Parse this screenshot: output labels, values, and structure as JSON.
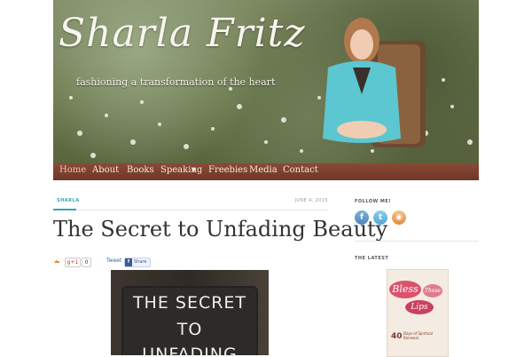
{
  "site": {
    "title": "Sharla Fritz",
    "tagline": "fashioning a transformation of the heart"
  },
  "nav": {
    "items": [
      "Home",
      "About",
      "Books",
      "Speaking",
      "Freebies",
      "Media",
      "Contact"
    ],
    "speaking_dropdown": "▾",
    "active": "Home"
  },
  "post": {
    "author": "SHARLA",
    "date": "JUNE 4, 2015",
    "title": "The Secret to Unfading Beauty",
    "share": {
      "gplus_label": "g+1",
      "gplus_count": "0",
      "tweet_label": "Tweet",
      "fb_label": "Share",
      "fb_icon": "f"
    },
    "image_lines": [
      "THE SECRET",
      "TO",
      "UNFADING"
    ]
  },
  "sidebar": {
    "follow_heading": "FOLLOW ME!",
    "social": [
      {
        "name": "facebook",
        "glyph": "f",
        "color": "#4f86b8"
      },
      {
        "name": "twitter",
        "glyph": "t",
        "color": "#4fa7cf"
      },
      {
        "name": "rss",
        "glyph": "◉",
        "color": "#e48a3a"
      }
    ],
    "latest_heading": "THE LATEST",
    "book": {
      "word1": "Bless",
      "word2": "These",
      "word3": "Lips",
      "number": "40",
      "subtitle": "Days of Spiritual Renewal"
    }
  },
  "colors": {
    "accent": "#3aa3b2",
    "nav_bg": "#7a3e2c",
    "title_text": "#333333"
  }
}
